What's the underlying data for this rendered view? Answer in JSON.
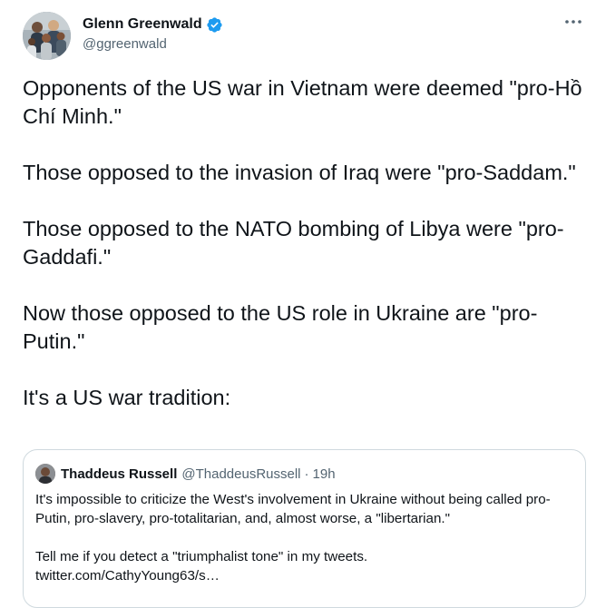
{
  "author": {
    "display_name": "Glenn Greenwald",
    "handle": "@ggreenwald",
    "verified": true,
    "verified_color": "#1d9bf0"
  },
  "more_menu": {
    "icon": "more-horizontal-icon"
  },
  "tweet": {
    "paragraphs": [
      "Opponents of the US war in Vietnam were deemed \"pro-Hồ Chí Minh.\"",
      "Those opposed to the invasion of Iraq were \"pro-Saddam.\"",
      "Those opposed to the NATO bombing of Libya were \"pro-Gaddafi.\"",
      "Now those opposed to the US role in Ukraine are \"pro-Putin.\"",
      "It's a US war tradition:"
    ]
  },
  "quoted_tweet": {
    "display_name": "Thaddeus Russell",
    "handle": "@ThaddeusRussell",
    "separator": "·",
    "time": "19h",
    "paragraphs": [
      "It's impossible to criticize the West's involvement in Ukraine without being called pro-Putin, pro-slavery, pro-totalitarian, and, almost worse, a \"libertarian.\"",
      "Tell me if you detect a \"triumphalist tone\" in my tweets.\ntwitter.com/CathyYoung63/s…"
    ]
  },
  "colors": {
    "text_primary": "#0f1419",
    "text_secondary": "#536471",
    "border": "#cfd9de",
    "verified_blue": "#1d9bf0"
  }
}
